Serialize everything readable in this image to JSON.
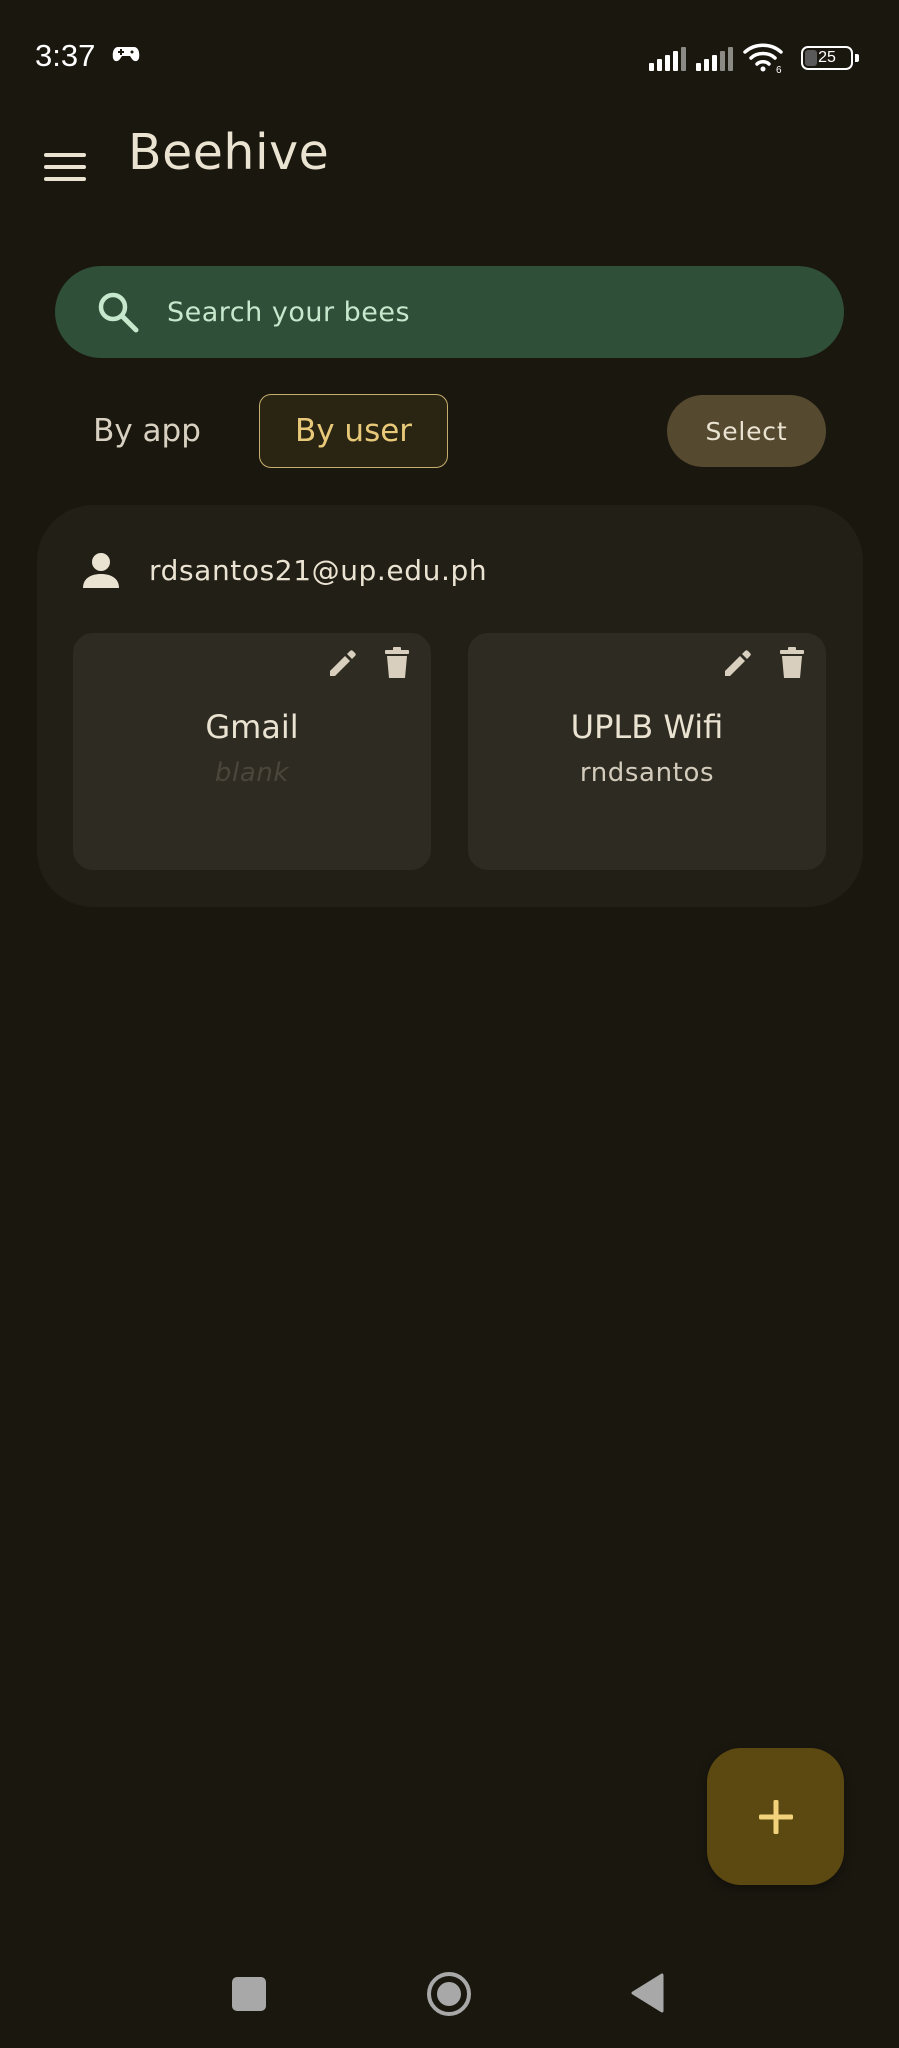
{
  "status_bar": {
    "time": "3:37",
    "battery_level": "25",
    "icons": [
      "game-controller-icon",
      "cell-signal-icon",
      "cell-signal-icon",
      "wifi-6-icon",
      "battery-icon"
    ]
  },
  "app_bar": {
    "title": "Beehive",
    "menu_icon": "hamburger-menu-icon"
  },
  "search": {
    "placeholder": "Search your bees",
    "icon": "search-icon"
  },
  "view_tabs": {
    "by_app": "By app",
    "by_user": "By user",
    "selected": "By user"
  },
  "select_button": "Select",
  "groups": [
    {
      "user": "rdsantos21@up.edu.ph",
      "entries": [
        {
          "title": "Gmail",
          "subtitle": "blank"
        },
        {
          "title": "UPLB Wifi",
          "subtitle": "rndsantos"
        }
      ]
    }
  ],
  "fab": {
    "icon": "plus-icon"
  },
  "colors": {
    "background": "#1a170f",
    "search_bg": "#2f4f38",
    "accent_gold": "#e8c97a",
    "fab_bg": "#5b4911",
    "select_bg": "#55492f",
    "card_bg": "#221f17"
  }
}
